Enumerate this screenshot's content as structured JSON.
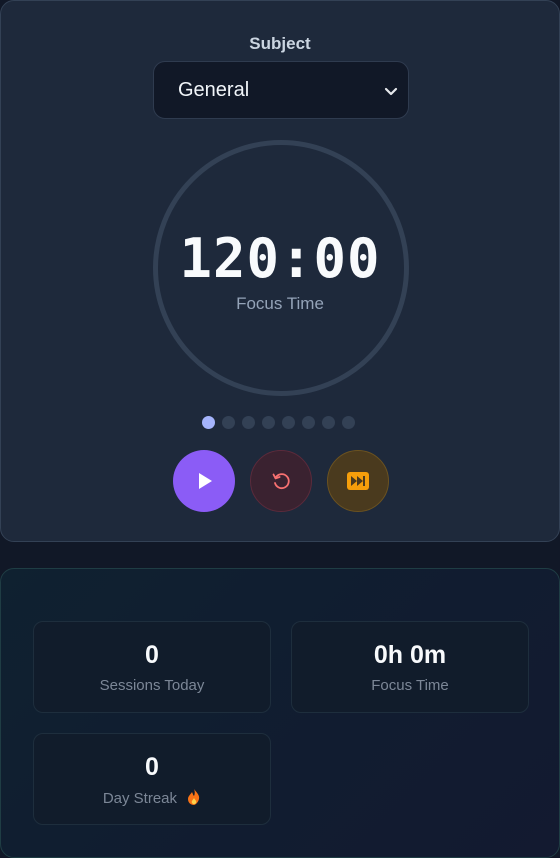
{
  "timer": {
    "subject_label": "Subject",
    "subject_selected": "General",
    "time": "120:00",
    "mode": "Focus Time",
    "session_dots": {
      "total": 8,
      "current": 1
    }
  },
  "controls": {
    "play_icon": "play-icon",
    "reset_icon": "reset-icon",
    "skip_icon": "skip-forward-icon"
  },
  "stats": {
    "sessions_today": {
      "value": "0",
      "label": "Sessions Today"
    },
    "focus_time": {
      "value": "0h 0m",
      "label": "Focus Time"
    },
    "day_streak": {
      "value": "0",
      "label": "Day Streak"
    }
  },
  "colors": {
    "accent": "#8b5cf6",
    "active_dot": "#a5b4fc",
    "reset": "#f87171",
    "skip": "#fbbf24"
  }
}
